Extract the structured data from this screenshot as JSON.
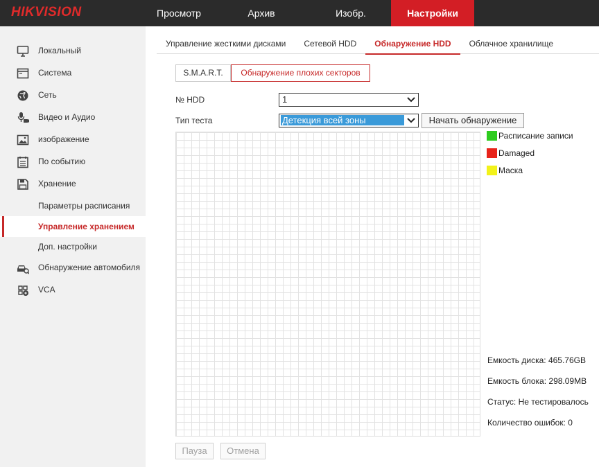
{
  "header": {
    "logo_text": "HIKVISION",
    "nav": [
      {
        "label": "Просмотр"
      },
      {
        "label": "Архив"
      },
      {
        "label": "Изобр."
      },
      {
        "label": "Настройки"
      }
    ]
  },
  "sidebar": {
    "items": [
      {
        "label": "Локальный",
        "icon": "monitor-icon"
      },
      {
        "label": "Система",
        "icon": "system-window-icon"
      },
      {
        "label": "Сеть",
        "icon": "globe-icon"
      },
      {
        "label": "Видео и Аудио",
        "icon": "microphone-camera-icon"
      },
      {
        "label": "изображение",
        "icon": "image-icon"
      },
      {
        "label": "По событию",
        "icon": "calendar-list-icon"
      },
      {
        "label": "Хранение",
        "icon": "floppy-disk-icon"
      }
    ],
    "sub_items": [
      {
        "label": "Параметры расписания"
      },
      {
        "label": "Управление хранением"
      },
      {
        "label": "Доп. настройки"
      }
    ],
    "items_after": [
      {
        "label": "Обнаружение автомобиля",
        "icon": "vehicle-search-icon"
      },
      {
        "label": "VCA",
        "icon": "vca-icon"
      }
    ]
  },
  "tabs": [
    {
      "label": "Управление жесткими дисками"
    },
    {
      "label": "Сетевой HDD"
    },
    {
      "label": "Обнаружение HDD"
    },
    {
      "label": "Облачное хранилище"
    }
  ],
  "subtabs": {
    "smart": "S.M.A.R.T.",
    "bad_sector": "Обнаружение плохих секторов"
  },
  "form": {
    "hdd_label": "№ HDD",
    "hdd_value": "1",
    "test_type_label": "Тип теста",
    "test_type_value": "Детекция всей зоны",
    "start_button": "Начать обнаружение"
  },
  "legend": [
    {
      "label": "Расписание записи",
      "color": "#2ecc1f"
    },
    {
      "label": "Damaged",
      "color": "#e8231a"
    },
    {
      "label": "Маска",
      "color": "#f2f21a"
    }
  ],
  "info": {
    "disk_capacity": "Емкость диска: 465.76GB",
    "block_capacity": "Емкость блока: 298.09MB",
    "status": "Статус: Не тестировалось",
    "error_count": "Количество ошибок: 0"
  },
  "buttons": {
    "pause": "Пауза",
    "cancel": "Отмена"
  },
  "colors": {
    "accent": "#c62828",
    "topbar": "#2b2b2b",
    "active_nav": "#d31e25"
  }
}
